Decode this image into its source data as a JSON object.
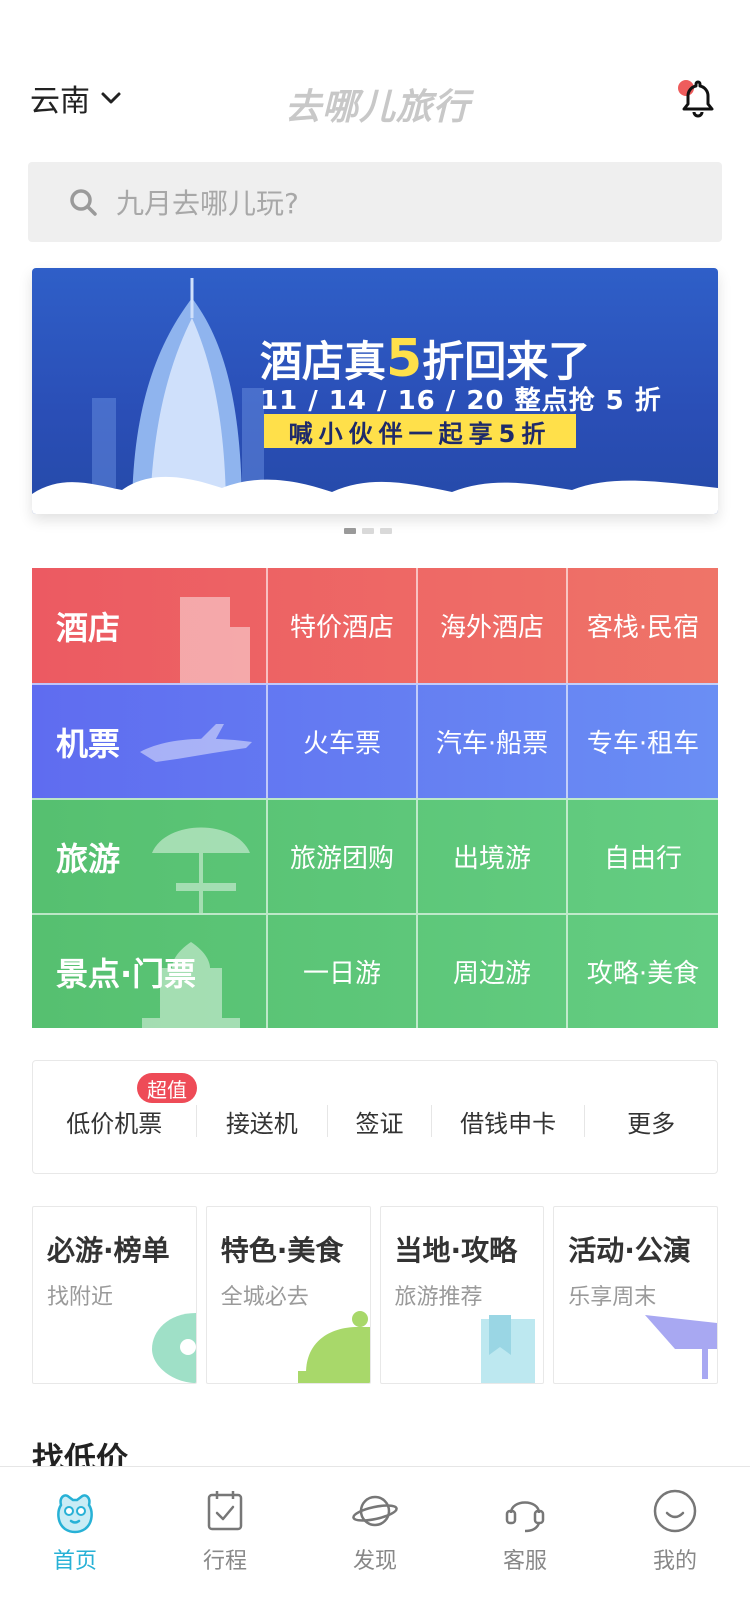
{
  "header": {
    "city": "云南",
    "logo": "去哪儿旅行"
  },
  "search": {
    "placeholder": "九月去哪儿玩?"
  },
  "banner": {
    "title_pre": "酒店真",
    "title_num": "5",
    "title_post": "折回来了",
    "subtitle": "11 / 14 / 16 / 20  整点抢 5 折",
    "tag": "喊小伙伴一起享5折",
    "dots": 3,
    "active_dot": 0
  },
  "grid": {
    "rows": [
      {
        "main": "酒店",
        "color": "#ec5a62",
        "cells": [
          "特价酒店",
          "海外酒店",
          "客栈·民宿"
        ]
      },
      {
        "main": "机票",
        "color": "#5f74f2",
        "cells": [
          "火车票",
          "汽车·船票",
          "专车·租车"
        ]
      },
      {
        "main": "旅游",
        "color": "#5cc876",
        "cells": [
          "旅游团购",
          "出境游",
          "自由行"
        ]
      },
      {
        "main": "景点·门票",
        "color": "#5cc876",
        "cells": [
          "一日游",
          "周边游",
          "攻略·美食"
        ]
      }
    ]
  },
  "quick": {
    "badge": "超值",
    "items": [
      "低价机票",
      "接送机",
      "签证",
      "借钱申卡",
      "更多"
    ]
  },
  "cards": [
    {
      "title": "必游·榜单",
      "sub": "找附近"
    },
    {
      "title": "特色·美食",
      "sub": "全城必去"
    },
    {
      "title": "当地·攻略",
      "sub": "旅游推荐"
    },
    {
      "title": "活动·公演",
      "sub": "乐享周末"
    }
  ],
  "section": {
    "title": "找低价"
  },
  "tabs": [
    {
      "label": "首页",
      "icon": "home-icon",
      "active": true
    },
    {
      "label": "行程",
      "icon": "itinerary-icon",
      "active": false
    },
    {
      "label": "发现",
      "icon": "discover-icon",
      "active": false
    },
    {
      "label": "客服",
      "icon": "support-icon",
      "active": false
    },
    {
      "label": "我的",
      "icon": "profile-icon",
      "active": false
    }
  ],
  "colors": {
    "accent": "#27b1d6",
    "notification_dot": "#ee5c5c",
    "badge": "#ee4b57"
  }
}
